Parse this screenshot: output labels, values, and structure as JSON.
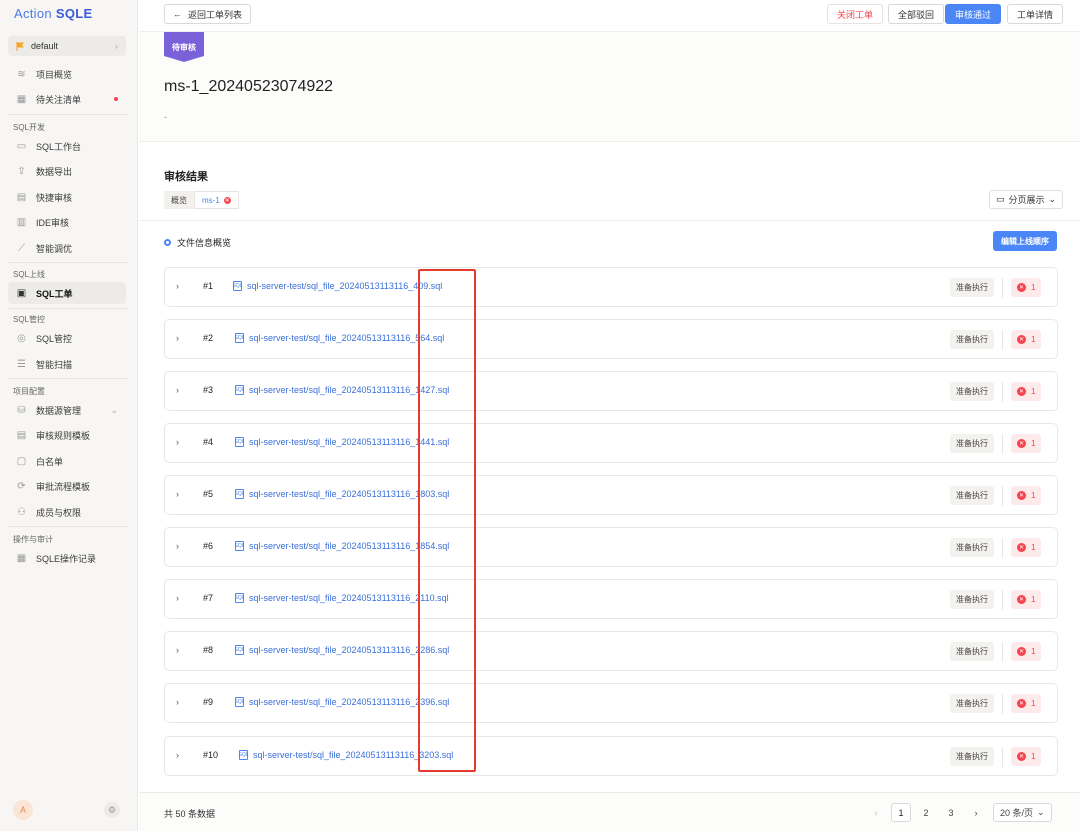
{
  "app": {
    "logo_a": "Action",
    "logo_b": "SQLE"
  },
  "sidebar": {
    "project": "default",
    "items": [
      {
        "label": "项目概览",
        "icon": "layers-icon"
      },
      {
        "label": "待关注清单",
        "icon": "checklist-icon"
      }
    ],
    "group_dev": "SQL开发",
    "dev_items": [
      {
        "label": "SQL工作台"
      },
      {
        "label": "数据导出"
      },
      {
        "label": "快捷审核"
      },
      {
        "label": "IDE审核"
      },
      {
        "label": "智能调优"
      }
    ],
    "group_release": "SQL上线",
    "release_items": [
      {
        "label": "SQL工单"
      }
    ],
    "group_control": "SQL管控",
    "control_items": [
      {
        "label": "SQL管控"
      },
      {
        "label": "智能扫描"
      }
    ],
    "group_config": "项目配置",
    "config_items": [
      {
        "label": "数据源管理"
      },
      {
        "label": "审核规则模板"
      },
      {
        "label": "白名单"
      },
      {
        "label": "审批流程模板"
      },
      {
        "label": "成员与权限"
      }
    ],
    "group_audit": "操作与审计",
    "audit_items": [
      {
        "label": "SQLE操作记录"
      }
    ],
    "avatar": "A"
  },
  "toolbar": {
    "back": "返回工单列表",
    "close": "关闭工单",
    "reject_all": "全部驳回",
    "approve": "审核通过",
    "detail": "工单详情"
  },
  "workorder": {
    "status": "待审核",
    "title": "ms-1_20240523074922",
    "desc": "-"
  },
  "result": {
    "title": "审核结果",
    "tabs": [
      "概览",
      "ms-1"
    ],
    "paging_mode": "分页展示",
    "file_info": "文件信息概览",
    "edit_order": "编辑上线顺序"
  },
  "rows": [
    {
      "num": "#1",
      "file": "sql-server-test/sql_file_20240513113116_409.sql",
      "status": "准备执行",
      "errors": "1"
    },
    {
      "num": "#2",
      "file": "sql-server-test/sql_file_20240513113116_564.sql",
      "status": "准备执行",
      "errors": "1"
    },
    {
      "num": "#3",
      "file": "sql-server-test/sql_file_20240513113116_1427.sql",
      "status": "准备执行",
      "errors": "1"
    },
    {
      "num": "#4",
      "file": "sql-server-test/sql_file_20240513113116_1441.sql",
      "status": "准备执行",
      "errors": "1"
    },
    {
      "num": "#5",
      "file": "sql-server-test/sql_file_20240513113116_1803.sql",
      "status": "准备执行",
      "errors": "1"
    },
    {
      "num": "#6",
      "file": "sql-server-test/sql_file_20240513113116_1854.sql",
      "status": "准备执行",
      "errors": "1"
    },
    {
      "num": "#7",
      "file": "sql-server-test/sql_file_20240513113116_2110.sql",
      "status": "准备执行",
      "errors": "1"
    },
    {
      "num": "#8",
      "file": "sql-server-test/sql_file_20240513113116_2286.sql",
      "status": "准备执行",
      "errors": "1"
    },
    {
      "num": "#9",
      "file": "sql-server-test/sql_file_20240513113116_2396.sql",
      "status": "准备执行",
      "errors": "1"
    },
    {
      "num": "#10",
      "file": "sql-server-test/sql_file_20240513113116_3203.sql",
      "status": "准备执行",
      "errors": "1"
    }
  ],
  "footer": {
    "total": "共 50 条数据",
    "pages": [
      "1",
      "2",
      "3"
    ],
    "page_size": "20 条/页"
  },
  "colors": {
    "accent": "#4a86f5",
    "danger": "#f5424e",
    "badge": "#7b61d9",
    "highlight": "#e73a2f"
  }
}
